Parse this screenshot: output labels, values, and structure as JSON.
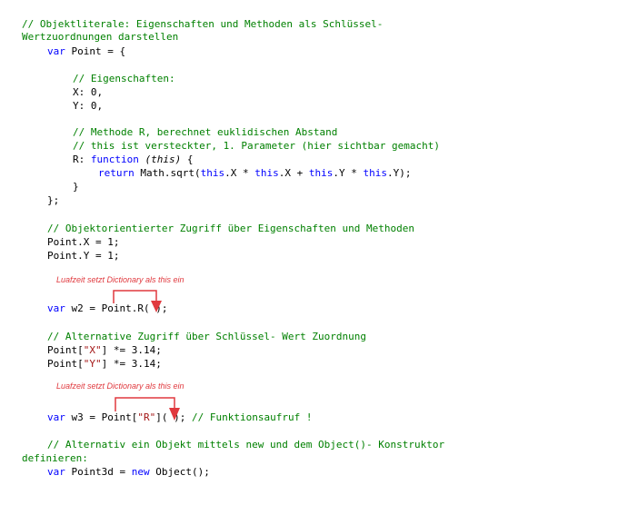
{
  "code": {
    "comment_intro_1": "// Objektliterale: Eigenschaften und Methoden als Schlüssel-",
    "comment_intro_2": "Wertzuordnungen darstellen",
    "kw_var": "var",
    "point_decl_rest": " Point = {",
    "comment_props": "// Eigenschaften:",
    "prop_x": "X: 0,",
    "prop_y": "Y: 0,",
    "comment_method_1": "// Methode R, berechnet euklidischen Abstand",
    "comment_method_2": "// this ist versteckter, 1. Parameter (hier sichtbar gemacht)",
    "method_r_label": "R: ",
    "kw_function": "function",
    "param_this": "(this)",
    "method_open": " {",
    "kw_return": "return",
    "return_expr_1": " Math.sqrt(",
    "kw_this": "this",
    "return_expr_2": ".X * ",
    "return_expr_3": ".X + ",
    "return_expr_4": ".Y * ",
    "return_expr_5": ".Y);",
    "brace_close": "}",
    "obj_close": "};",
    "comment_access": "// Objektorientierter Zugriff über Eigenschaften und Methoden",
    "assign_x": "Point.X = 1;",
    "assign_y": "Point.Y = 1;",
    "w2_rest": " w2 = Point.R( );",
    "comment_alt": "// Alternative Zugriff über Schlüssel- Wert Zuordnung",
    "index_x_1": "Point[",
    "index_x_key": "\"X\"",
    "index_x_2": "] *= 3.14;",
    "index_y_1": "Point[",
    "index_y_key": "\"Y\"",
    "index_y_2": "] *= 3.14;",
    "w3_1": " w3 = Point[",
    "w3_key": "\"R\"",
    "w3_2": "]( ); ",
    "w3_comment": "// Funktionsaufruf !",
    "comment_ctor_1": "// Alternativ ein Objekt mittels new und dem Object()- Konstruktor",
    "comment_ctor_2": "definieren:",
    "point3d_1": " Point3d = ",
    "kw_new": "new",
    "point3d_2": " Object();"
  },
  "annotations": {
    "label_1": "Luafzeit setzt Dictionary als this ein",
    "label_2": "Luafzeit setzt Dictionary als this ein",
    "color": "#e0393e"
  },
  "colors": {
    "comment": "#008000",
    "keyword": "#0000ff",
    "string": "#a31515",
    "annotation": "#e0393e"
  }
}
